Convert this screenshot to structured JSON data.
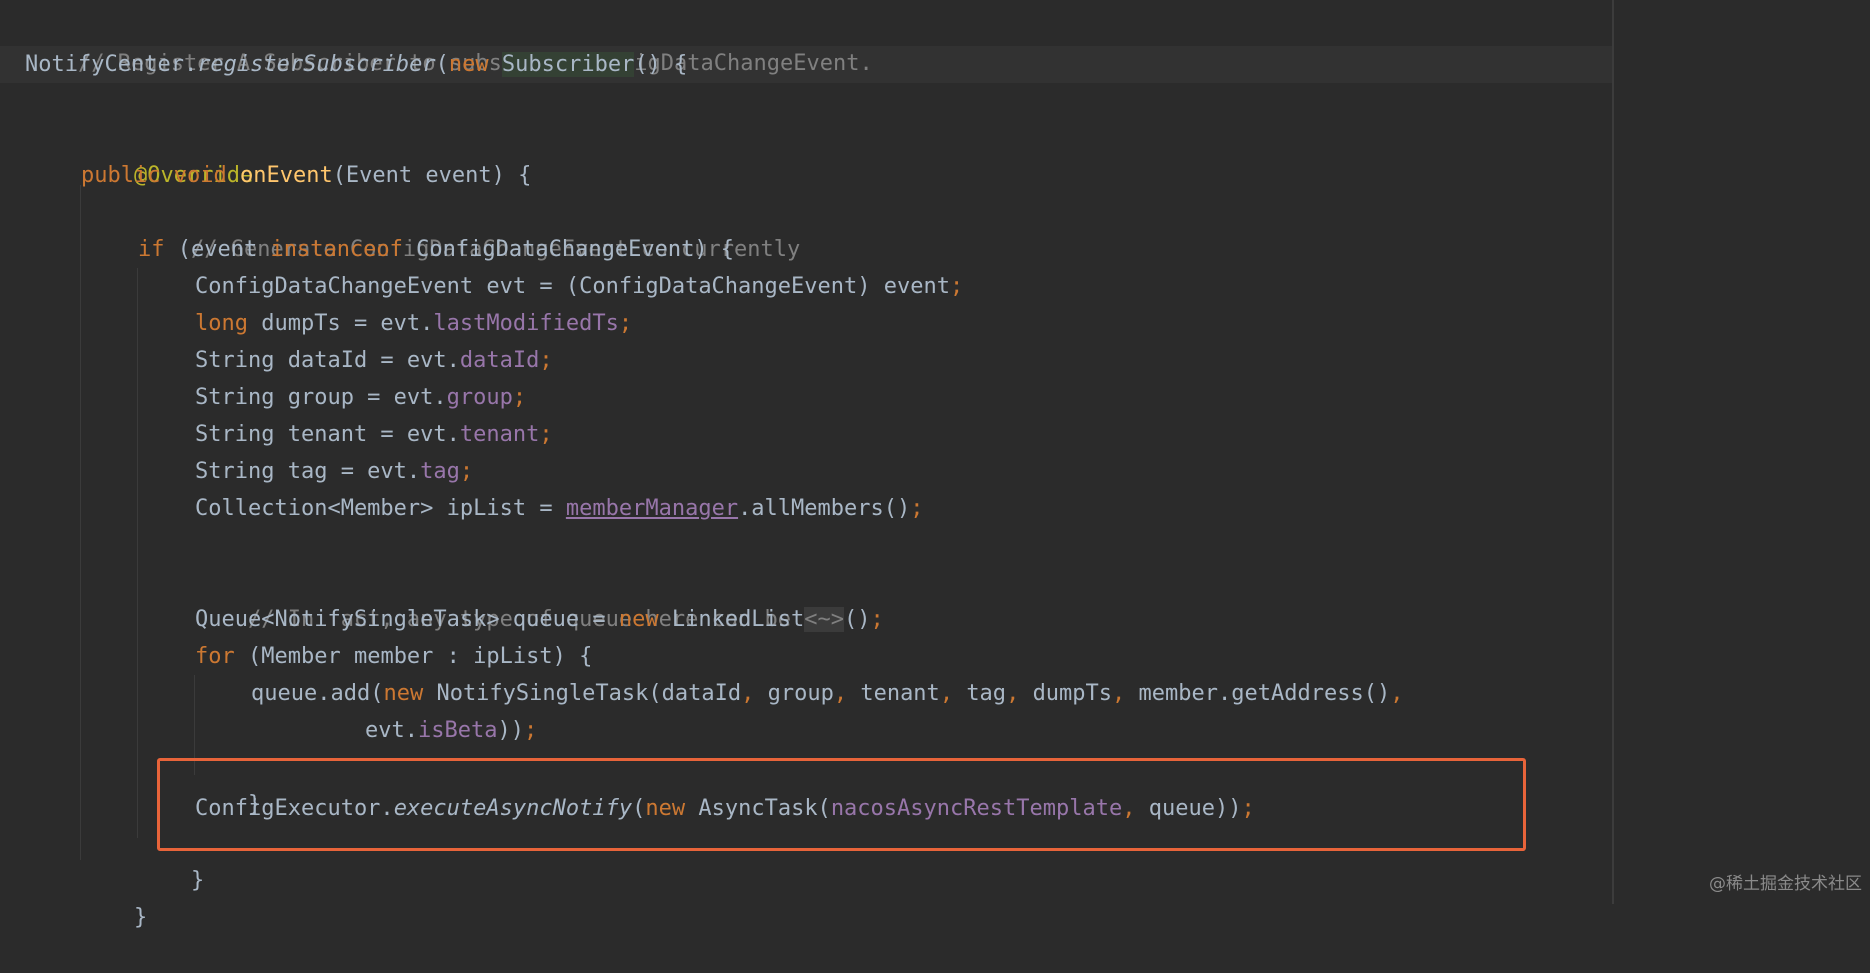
{
  "code": {
    "l1_comment": "// Register A Subscriber to subscribe ConfigDataChangeEvent.",
    "l2_a": "NotifyCenter.",
    "l2_b": "registerSubscriber",
    "l2_c": "(",
    "l2_d": "new",
    "l2_e": " ",
    "l2_f": "Subscriber",
    "l2_g": "() {",
    "l4_ann": "@Override",
    "l5_a": "public",
    "l5_b": " ",
    "l5_c": "void",
    "l5_d": " ",
    "l5_e": "onEvent",
    "l5_f": "(Event event) {",
    "l6_comment": "// Generate ConfigDataChangeEvent concurrently",
    "l7_a": "if",
    "l7_b": " (event ",
    "l7_c": "instanceof",
    "l7_d": " ConfigDataChangeEvent) {",
    "l8_a": "ConfigDataChangeEvent evt = (ConfigDataChangeEvent) event",
    "l8_b": ";",
    "l9_a": "long",
    "l9_b": " dumpTs = evt.",
    "l9_c": "lastModifiedTs",
    "l9_d": ";",
    "l10_a": "String dataId = evt.",
    "l10_b": "dataId",
    "l10_c": ";",
    "l11_a": "String group = evt.",
    "l11_b": "group",
    "l11_c": ";",
    "l12_a": "String tenant = evt.",
    "l12_b": "tenant",
    "l12_c": ";",
    "l13_a": "String tag = evt.",
    "l13_b": "tag",
    "l13_c": ";",
    "l14_a": "Collection<Member> ipList = ",
    "l14_b": "memberManager",
    "l14_c": ".allMembers()",
    "l14_d": ";",
    "l16_comment": "// In fact, any type of queue here can be",
    "l17_a": "Queue<NotifySingleTask> queue = ",
    "l17_b": "new",
    "l17_c": " LinkedList",
    "l17_d": "<~>",
    "l17_e": "()",
    "l17_f": ";",
    "l18_a": "for",
    "l18_b": " (Member member : ipList) {",
    "l19_a": "queue.add(",
    "l19_b": "new",
    "l19_c": " NotifySingleTask(dataId",
    "l19_d": ", ",
    "l19_e": "group",
    "l19_f": ", ",
    "l19_g": "tenant",
    "l19_h": ", ",
    "l19_i": "tag",
    "l19_j": ", ",
    "l19_k": "dumpTs",
    "l19_l": ", ",
    "l19_m": "member.getAddress()",
    "l19_n": ",",
    "l20_a": "evt.",
    "l20_b": "isBeta",
    "l20_c": "))",
    "l20_d": ";",
    "l21_brace": "}",
    "l22_a": "ConfigExecutor.",
    "l22_b": "executeAsyncNotify",
    "l22_c": "(",
    "l22_d": "new",
    "l22_e": " AsyncTask(",
    "l22_f": "nacosAsyncRestTemplate",
    "l22_g": ", ",
    "l22_h": "queue))",
    "l22_i": ";",
    "l23_brace": "}",
    "l24_brace": "}"
  },
  "watermark": "@稀土掘金技术社区",
  "colors": {
    "background": "#2b2b2b",
    "keyword": "#cc7832",
    "comment": "#808080",
    "annotation": "#bbb529",
    "method": "#ffc66d",
    "field": "#9876aa",
    "text": "#a9b7c6",
    "highlight_box": "#e8643a"
  }
}
